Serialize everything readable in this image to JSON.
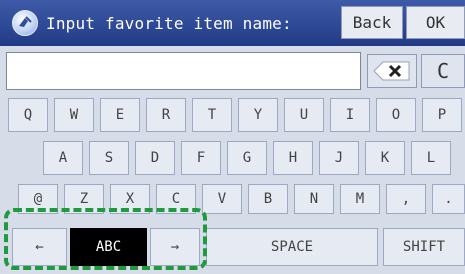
{
  "header": {
    "title": "Input favorite item name:",
    "icon": "favorite-globe-icon",
    "back_label": "Back",
    "ok_label": "OK"
  },
  "input": {
    "value": ""
  },
  "editing": {
    "clear_label": "C",
    "backspace_icon": "backspace-icon"
  },
  "keyboard": {
    "row1": [
      "Q",
      "W",
      "E",
      "R",
      "T",
      "Y",
      "U",
      "I",
      "O",
      "P"
    ],
    "row2": [
      "A",
      "S",
      "D",
      "F",
      "G",
      "H",
      "J",
      "K",
      "L"
    ],
    "row3": [
      "@",
      "Z",
      "X",
      "C",
      "V",
      "B",
      "N",
      "M",
      ",",
      "."
    ],
    "bottom": {
      "left_arrow": "←",
      "mode": "ABC",
      "right_arrow": "→",
      "space": "SPACE",
      "shift": "SHIFT"
    }
  },
  "colors": {
    "title_bar": "#2b4593",
    "highlight": "#1f9a3e",
    "selected_key": "#000000"
  }
}
